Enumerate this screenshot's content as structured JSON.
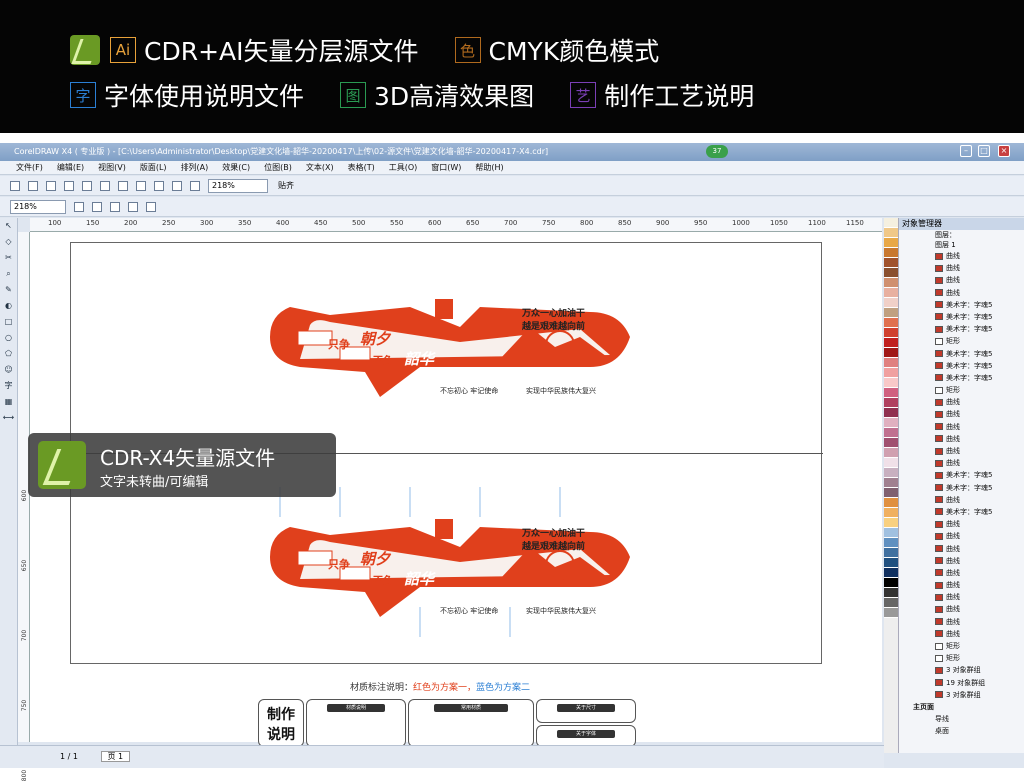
{
  "banner": {
    "items": [
      {
        "icon_text": "Ai",
        "label": "CDR+AI矢量分层源文件",
        "color": "#e8a23a"
      },
      {
        "icon_text": "色",
        "label": "CMYK颜色模式",
        "color": "#b06a1e"
      },
      {
        "icon_text": "字",
        "label": "字体使用说明文件",
        "color": "#2b7fd4"
      },
      {
        "icon_text": "图",
        "label": "3D高清效果图",
        "color": "#2a9a52"
      },
      {
        "icon_text": "艺",
        "label": "制作工艺说明",
        "color": "#7b3fb6"
      }
    ]
  },
  "window": {
    "title": "CorelDRAW X4 ( 专业版 ) - [C:\\Users\\Administrator\\Desktop\\党建文化墙-韶华-20200417\\上传\\02-源文件\\党建文化墙-韶华-20200417-X4.cdr]",
    "badge_count": "37",
    "menu": [
      "文件(F)",
      "编辑(E)",
      "视图(V)",
      "版面(L)",
      "排列(A)",
      "效果(C)",
      "位图(B)",
      "文本(X)",
      "表格(T)",
      "工具(O)",
      "窗口(W)",
      "帮助(H)"
    ],
    "zoom": "218%",
    "zoom2": "218%",
    "snap_label": "贴齐",
    "ruler_ticks": [
      "100",
      "150",
      "200",
      "250",
      "300",
      "350",
      "400",
      "450",
      "500",
      "550",
      "600",
      "650",
      "700",
      "750",
      "800",
      "850",
      "900",
      "950",
      "1000",
      "1050",
      "1100",
      "1150"
    ],
    "vruler_ticks": [
      "600",
      "650",
      "700",
      "750",
      "800"
    ],
    "page_indicator": "1 / 1",
    "page_tab": "页 1"
  },
  "design": {
    "slogan_left_1": "只争",
    "slogan_left_2": "朝夕",
    "slogan_left_3": "不负",
    "slogan_left_4": "韶华",
    "slogan_right_1": "万众一心加油干",
    "slogan_right_2": "越是艰难越向前",
    "footer_1": "不忘初心 牢记使命",
    "footer_2": "实现中华民族伟大复兴"
  },
  "material": {
    "legend_prefix": "材质标注说明：",
    "legend_red": "红色为方案一，",
    "legend_blue": "蓝色为方案二",
    "make_label_1": "制作",
    "make_label_2": "说明",
    "boxes": [
      "材质说明",
      "常用材质",
      "关于尺寸",
      "关于字体"
    ]
  },
  "badge": {
    "title": "CDR-X4矢量源文件",
    "subtitle": "文字未转曲/可编辑"
  },
  "docker": {
    "title": "对象管理器",
    "layer1": "图层：",
    "layer2": "图层 1",
    "items": [
      "曲线",
      "曲线",
      "曲线",
      "曲线",
      "美术字：字魂5",
      "美术字：字魂5",
      "美术字：字魂5",
      "矩形",
      "美术字：字魂5",
      "美术字：字魂5",
      "美术字：字魂5",
      "矩形",
      "曲线",
      "曲线",
      "曲线",
      "曲线",
      "曲线",
      "曲线",
      "美术字：字魂5",
      "美术字：字魂5",
      "曲线",
      "美术字：字魂5",
      "曲线",
      "曲线",
      "曲线",
      "曲线",
      "曲线",
      "曲线",
      "曲线",
      "曲线",
      "曲线",
      "曲线",
      "矩形",
      "矩形",
      "3 对象群组",
      "19 对象群组",
      "3 对象群组"
    ],
    "master": "主页面",
    "sub1": "导线",
    "sub2": "桌面"
  },
  "palette_colors": [
    "#f5f0e0",
    "#f0c888",
    "#e8a848",
    "#c87830",
    "#a0522d",
    "#8a5030",
    "#d09070",
    "#e8b0a0",
    "#f0d0c8",
    "#c0a080",
    "#e07050",
    "#d04030",
    "#c02020",
    "#a01818",
    "#e08080",
    "#f0a0a0",
    "#f8c8c8",
    "#d06080",
    "#b04060",
    "#903050",
    "#e0b0c0",
    "#c07090",
    "#a05070",
    "#d0a0b0",
    "#f0e0e8",
    "#c8b0c0",
    "#a08090",
    "#806070",
    "#e09040",
    "#f0b060",
    "#f8d080",
    "#a0c0e0",
    "#6090c0",
    "#4070a0",
    "#205080",
    "#103060",
    "#000000",
    "#333333",
    "#666666",
    "#999999"
  ]
}
